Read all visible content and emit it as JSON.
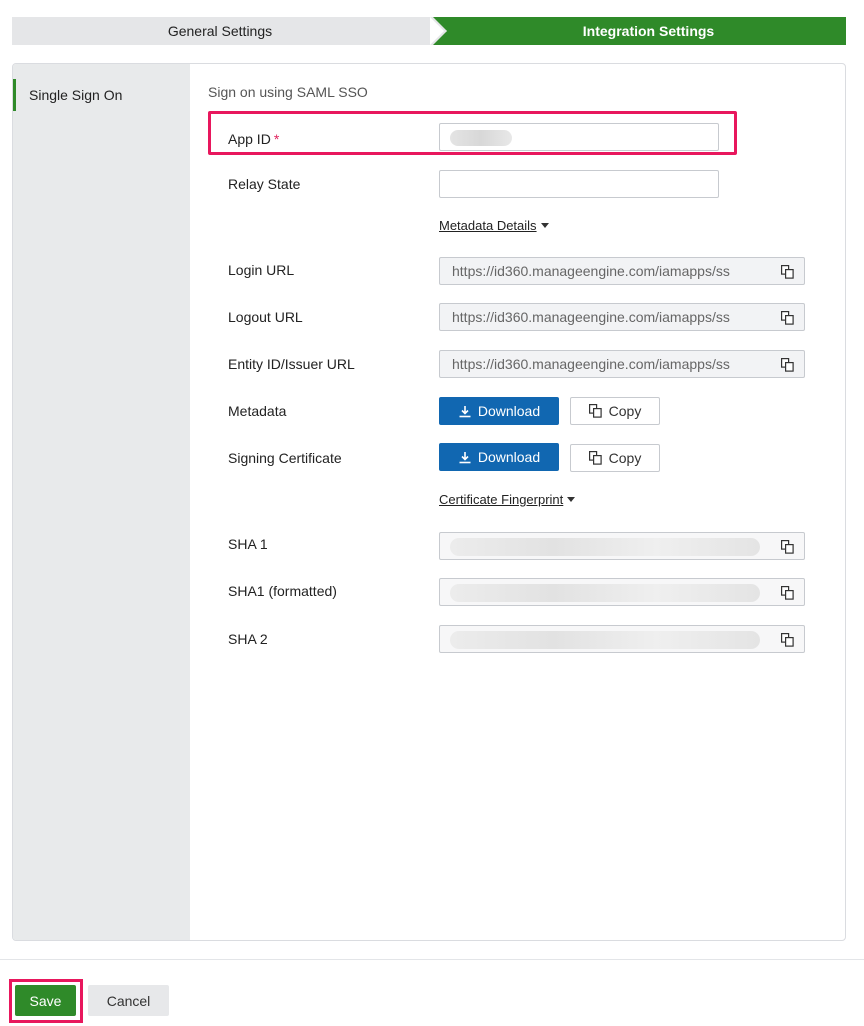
{
  "wizard": {
    "steps": [
      {
        "label": "General Settings",
        "state": "completed"
      },
      {
        "label": "Integration Settings",
        "state": "active"
      }
    ],
    "active_color": "#2f8a29"
  },
  "sidebar": {
    "items": [
      {
        "label": "Single Sign On",
        "selected": true
      }
    ]
  },
  "form": {
    "section_title": "Sign on using SAML SSO",
    "app_id": {
      "label": "App ID",
      "required_mark": "*",
      "value": ""
    },
    "relay_state": {
      "label": "Relay State",
      "value": ""
    },
    "metadata_details_toggle": "Metadata Details",
    "login_url": {
      "label": "Login URL",
      "value": "https://id360.manageengine.com/iamapps/ss"
    },
    "logout_url": {
      "label": "Logout URL",
      "value": "https://id360.manageengine.com/iamapps/ss"
    },
    "entity_id": {
      "label": "Entity ID/Issuer URL",
      "value": "https://id360.manageengine.com/iamapps/ss"
    },
    "metadata": {
      "label": "Metadata",
      "download_label": "Download",
      "copy_label": "Copy"
    },
    "signing_certificate": {
      "label": "Signing Certificate",
      "download_label": "Download",
      "copy_label": "Copy"
    },
    "certificate_fingerprint_toggle": "Certificate Fingerprint",
    "sha1": {
      "label": "SHA 1"
    },
    "sha1_formatted": {
      "label": "SHA1 (formatted)"
    },
    "sha2": {
      "label": "SHA 2"
    }
  },
  "footer": {
    "save_label": "Save",
    "cancel_label": "Cancel"
  },
  "colors": {
    "primary_green": "#2f8a29",
    "download_blue": "#1167b1",
    "highlight_pink": "#e8175d"
  },
  "icons": [
    "copy-icon",
    "download-icon",
    "caret-down-icon"
  ]
}
